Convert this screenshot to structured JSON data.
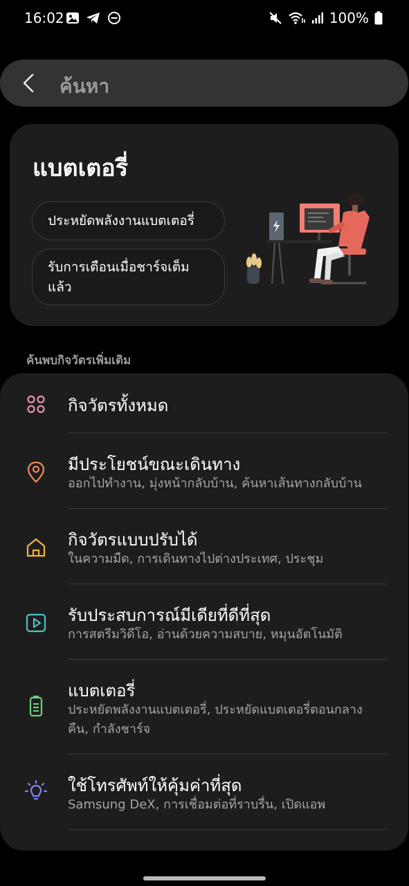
{
  "status_bar": {
    "time": "16:02",
    "battery_percent": "100%",
    "left_icons": [
      "gallery-icon",
      "telegram-icon",
      "do-not-disturb-icon"
    ],
    "right_icons": [
      "mute-icon",
      "wifi-icon",
      "signal-icon",
      "battery-icon"
    ]
  },
  "search": {
    "text": "ค้นหา"
  },
  "battery_card": {
    "title": "แบตเตอรี่",
    "chips": [
      "ประหยัดพลังงานแบตเตอรี่",
      "รับการเตือนเมื่อชาร์จเต็มแล้ว"
    ]
  },
  "section_header": "ค้นพบกิจวัตรเพิ่มเติม",
  "routines": [
    {
      "title": "กิจวัตรทั้งหมด",
      "subtitle": "",
      "icon": "grid-icon",
      "color": "#e58fb4"
    },
    {
      "title": "มีประโยชน์ขณะเดินทาง",
      "subtitle": "ออกไปทำงาน, มุ่งหน้ากลับบ้าน, ค้นหาเส้นทางกลับบ้าน",
      "icon": "location-pin-icon",
      "color": "#f08c5a"
    },
    {
      "title": "กิจวัตรแบบปรับได้",
      "subtitle": "ในความมืด, การเดินทางไปต่างประเทศ, ประชุม",
      "icon": "home-icon",
      "color": "#f2b43c"
    },
    {
      "title": "รับประสบการณ์มีเดียที่ดีที่สุด",
      "subtitle": "การสตรีมวิดีโอ, อ่านด้วยความสบาย, หมุนอัตโนมัติ",
      "icon": "play-icon",
      "color": "#4fc2c0"
    },
    {
      "title": "แบตเตอรี่",
      "subtitle": "ประหยัดพลังงานแบตเตอรี่, ประหยัดแบตเตอรี่ตอนกลางคืน, กำลังชาร์จ",
      "icon": "battery-icon",
      "color": "#6ccf7f"
    },
    {
      "title": "ใช้โทรศัพท์ให้คุ้มค่าที่สุด",
      "subtitle": "Samsung DeX, การเชื่อมต่อที่ราบรื่น, เปิดแอพ",
      "icon": "lightbulb-icon",
      "color": "#7f86f0"
    }
  ]
}
